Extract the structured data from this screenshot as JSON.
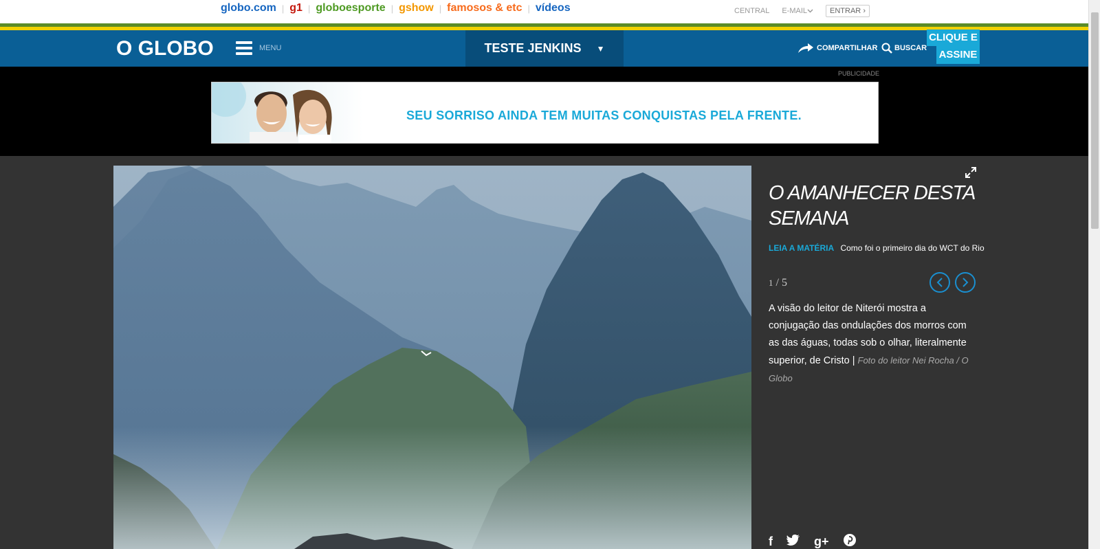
{
  "topbar": {
    "links": [
      {
        "label": "globo.com",
        "color": "#1565c0"
      },
      {
        "label": "g1",
        "color": "#c4170c"
      },
      {
        "label": "globoesporte",
        "color": "#4e9a23"
      },
      {
        "label": "gshow",
        "color": "#f39700"
      },
      {
        "label": "famosos & etc",
        "color": "#f76b1c"
      },
      {
        "label": "vídeos",
        "color": "#1565c0"
      }
    ],
    "central": "CENTRAL",
    "email": "E-MAIL",
    "entrar": "ENTRAR"
  },
  "header": {
    "logo": "O GLOBO",
    "menu_label": "MENU",
    "section": "TESTE JENKINS",
    "share_label": "COMPARTILHAR",
    "search_label": "BUSCAR",
    "subscribe_line1": "CLIQUE E",
    "subscribe_line2": "ASSINE"
  },
  "ad": {
    "publicidade": "PUBLICIDADE",
    "banner_text": "SEU SORRISO AINDA TEM MUITAS CONQUISTAS PELA FRENTE."
  },
  "gallery": {
    "title": "O AMANHECER DESTA SEMANA",
    "read_more_label": "LEIA A MATÉRIA",
    "read_more_text": "Como foi o primeiro dia do WCT do Rio",
    "counter_current": "1",
    "counter_total": "5",
    "description": "A visão do leitor de Niterói mostra a conjugação das ondulações dos morros com as das águas, todas sob o olhar, literalmente superior, de Cristo",
    "credit": "Foto do leitor Nei Rocha / O Globo",
    "icons": [
      "expand-icon",
      "prev-arrow-icon",
      "next-arrow-icon",
      "facebook-icon",
      "twitter-icon",
      "google-plus-icon",
      "pinterest-icon"
    ]
  },
  "colors": {
    "header_blue": "#0a5f96",
    "accent_cyan": "#1aa9d8",
    "green_stripe": "#5a8b28",
    "yellow_stripe": "#f1d100"
  }
}
